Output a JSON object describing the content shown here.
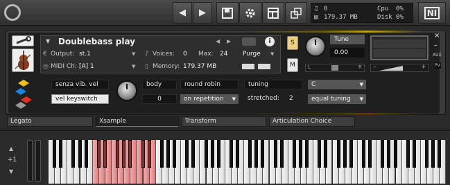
{
  "topbar": {
    "logo_icon": "power-icon",
    "nav": [
      "◀",
      "▶"
    ],
    "buttons": [
      "save-icon",
      "gear-icon",
      "layout-icon",
      "resize-icon"
    ],
    "midi_count": "0",
    "memory": "179.37 MB",
    "cpu_label": "Cpu",
    "cpu_value": "0%",
    "disk_label": "Disk",
    "disk_value": "0%",
    "ni_logo": "NI"
  },
  "instrument": {
    "title": "Doublebass play",
    "output_label": "Output:",
    "output_value": "st.1",
    "voices_label": "Voices:",
    "voices_value": "0",
    "max_label": "Max:",
    "max_value": "24",
    "purge_label": "Purge",
    "midi_label": "MIDI Ch:",
    "midi_value": "[A]  1",
    "memory_label": "Memory:",
    "memory_value": "179.37 MB",
    "tune_label": "Tune",
    "tune_value": "0.00",
    "s_label": "S",
    "m_label": "M",
    "l_label": "L",
    "r_label": "R",
    "aux_label": "AUX",
    "pv_label": "PV",
    "close": "×",
    "minimize": "–"
  },
  "controls": {
    "senza": "senza vib. vel",
    "vel_keyswitch": "vel keyswitch",
    "body_label": "body",
    "body_value": "0",
    "round_robin": "round robin",
    "on_repetition": "on repetition",
    "tuning": "tuning",
    "stretched_label": "stretched:",
    "stretched_value": "2",
    "key": "C",
    "equal_tuning": "equal tuning"
  },
  "tabs": [
    "Legato",
    "Xsample",
    "Transform",
    "Articulation Choice"
  ],
  "keyboard": {
    "octave": "+1"
  }
}
